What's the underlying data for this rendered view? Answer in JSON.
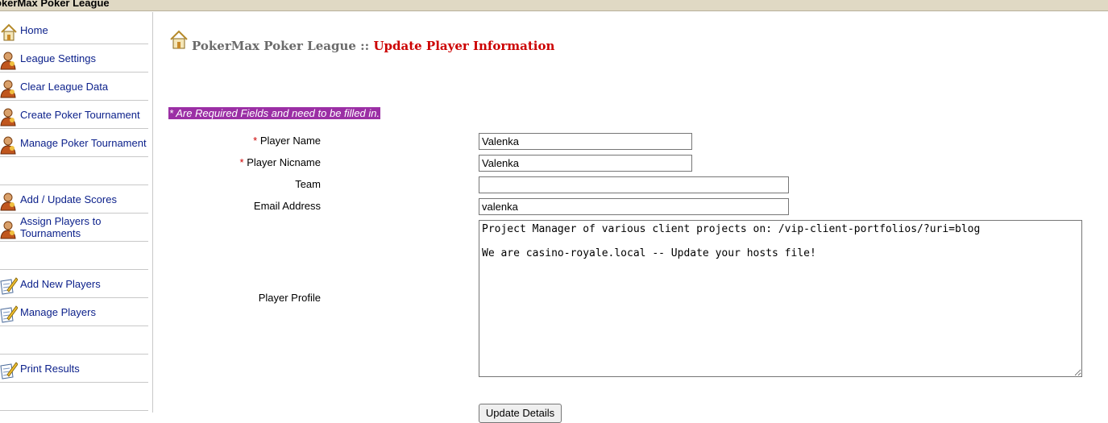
{
  "app": {
    "title": "okerMax Poker League"
  },
  "sidebar": {
    "items": [
      {
        "label": "Home",
        "icon": "house-icon"
      },
      {
        "label": "League Settings",
        "icon": "user-icon"
      },
      {
        "label": "Clear League Data",
        "icon": "user-icon"
      },
      {
        "label": "Create Poker Tournament",
        "icon": "user-icon"
      },
      {
        "label": "Manage Poker Tournament",
        "icon": "user-icon"
      },
      {
        "label": "",
        "icon": ""
      },
      {
        "label": "Add / Update Scores",
        "icon": "user-icon"
      },
      {
        "label": "Assign Players to Tournaments",
        "icon": "user-icon"
      },
      {
        "label": "",
        "icon": ""
      },
      {
        "label": "Add New Players",
        "icon": "edit-document-icon"
      },
      {
        "label": "Manage Players",
        "icon": "edit-document-icon"
      },
      {
        "label": "",
        "icon": ""
      },
      {
        "label": "Print Results",
        "icon": "edit-document-icon"
      },
      {
        "label": "",
        "icon": ""
      }
    ]
  },
  "header": {
    "league": "PokerMax Poker League",
    "separator": "::",
    "page_title": "Update Player Information"
  },
  "form": {
    "required_note": "* Are Required Fields and need to be filled in.",
    "required_marker": "*",
    "player_name": {
      "label": "Player Name",
      "value": "Valenka",
      "required": true
    },
    "player_nickname": {
      "label": "Player Nicname",
      "value": "Valenka",
      "required": true
    },
    "team": {
      "label": "Team",
      "value": ""
    },
    "email": {
      "label": "Email Address",
      "value": "valenka"
    },
    "profile": {
      "label": "Player Profile",
      "value": "Project Manager of various client projects on: /vip-client-portfolios/?uri=blog\n\nWe are casino-royale.local -- Update your hosts file!"
    },
    "submit_label": "Update Details"
  },
  "colors": {
    "titlebar_bg": "#e0d9c4",
    "link": "#0a1f8a",
    "page_title": "#cc0000",
    "required_note_bg": "#9b2fa5"
  }
}
